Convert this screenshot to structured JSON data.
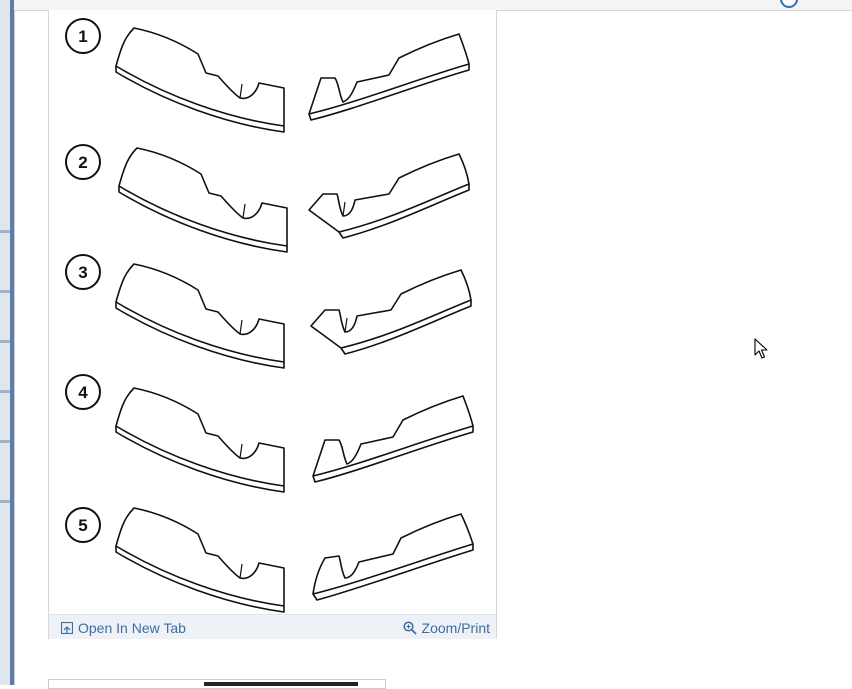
{
  "figure": {
    "steps": [
      "1",
      "2",
      "3",
      "4",
      "5"
    ],
    "footer": {
      "open_label": "Open In New Tab",
      "zoom_label": "Zoom/Print"
    }
  },
  "icons": {
    "open": "open-new-tab-icon",
    "zoom": "zoom-magnifier-icon",
    "cursor": "mouse-pointer-icon"
  },
  "colors": {
    "link": "#3a6ea5",
    "footer_bg": "#eef1f5"
  }
}
